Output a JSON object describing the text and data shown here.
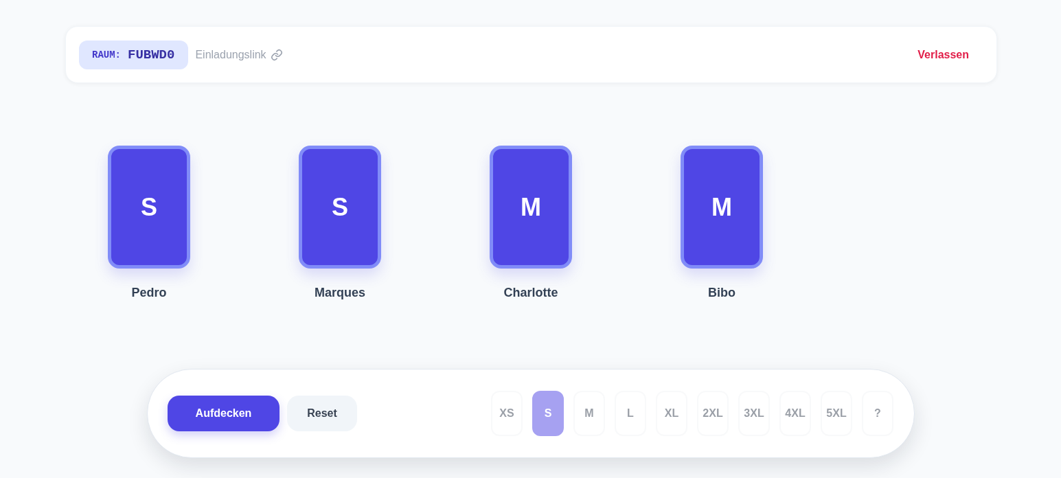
{
  "room": {
    "label": "RAUM:",
    "code": "FUBWD0"
  },
  "invite_link": {
    "label": "Einladungslink"
  },
  "leave_button": {
    "label": "Verlassen"
  },
  "players": [
    {
      "name": "Pedro",
      "card": "S"
    },
    {
      "name": "Marques",
      "card": "S"
    },
    {
      "name": "Charlotte",
      "card": "M"
    },
    {
      "name": "Bibo",
      "card": "M"
    }
  ],
  "actions": [
    {
      "kind": "primary",
      "label": "Aufdecken"
    },
    {
      "kind": "secondary",
      "label": "Reset"
    }
  ],
  "sizes": [
    {
      "label": "XS",
      "selected": false,
      "disabled": true
    },
    {
      "label": "S",
      "selected": true,
      "disabled": true
    },
    {
      "label": "M",
      "selected": false,
      "disabled": true
    },
    {
      "label": "L",
      "selected": false,
      "disabled": true
    },
    {
      "label": "XL",
      "selected": false,
      "disabled": true
    },
    {
      "label": "2XL",
      "selected": false,
      "disabled": true
    },
    {
      "label": "3XL",
      "selected": false,
      "disabled": true
    },
    {
      "label": "4XL",
      "selected": false,
      "disabled": true
    },
    {
      "label": "5XL",
      "selected": false,
      "disabled": true
    },
    {
      "label": "?",
      "selected": false,
      "disabled": true
    }
  ]
}
